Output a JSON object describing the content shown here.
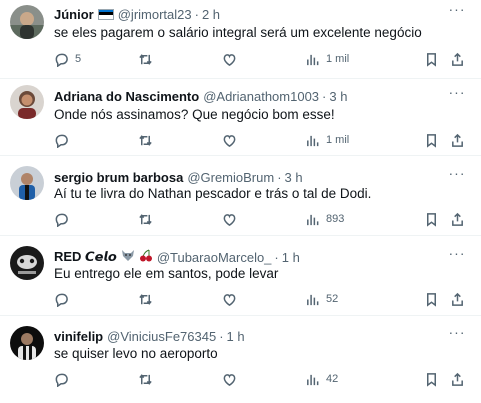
{
  "tweets": [
    {
      "name": "Júnior",
      "handle": "@jrimortal23",
      "time": "2 h",
      "text": "se eles pagarem o salário integral será um excelente negócio",
      "replies": "5",
      "retweets": "",
      "likes": "",
      "views": "1 mil",
      "badge": "estonian-flag-icon"
    },
    {
      "name": "Adriana do Nascimento",
      "handle": "@Adrianathom1003",
      "time": "3 h",
      "text": "Onde nós assinamos? Que negócio bom esse!",
      "replies": "",
      "retweets": "",
      "likes": "",
      "views": "1 mil"
    },
    {
      "name": "sergio brum barbosa",
      "handle": "@GremioBrum",
      "time": "3 h",
      "text": "Aí tu te livra do Nathan pescador e trás o tal de Dodi.",
      "replies": "",
      "retweets": "",
      "likes": "",
      "views": "893"
    },
    {
      "name": "RED 𝘾𝙚𝙡𝙤",
      "handle": "@TubaraoMarcelo_",
      "time": "1 h",
      "text": "Eu entrego ele em santos, pode levar",
      "replies": "",
      "retweets": "",
      "likes": "",
      "views": "52",
      "badges": [
        "wolf-icon",
        "cherries-icon"
      ]
    },
    {
      "name": "vinifelip",
      "handle": "@ViniciusFe76345",
      "time": "1 h",
      "text": "se quiser levo no aeroporto",
      "replies": "",
      "retweets": "",
      "likes": "",
      "views": "42"
    }
  ],
  "sep": "·",
  "colors": {
    "text": "#0f1419",
    "secondary": "#536471",
    "divider": "#eff3f4"
  }
}
